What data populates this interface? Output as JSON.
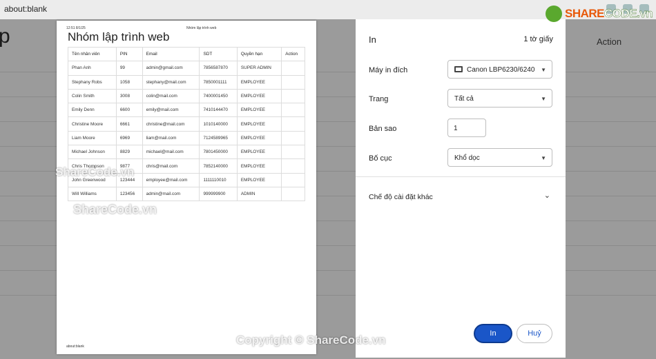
{
  "browser": {
    "url": "about:blank"
  },
  "background_page": {
    "left_glyph": "p",
    "action_label": "Action"
  },
  "sheet": {
    "header_left": "12:51 8/1/25",
    "header_center": "Nhóm lập trình web",
    "title": "Nhóm lập trình web",
    "footer": "about:blank",
    "columns": [
      "Tên nhân viên",
      "PIN",
      "Email",
      "SDT",
      "Quyền hạn",
      "Action"
    ],
    "rows": [
      [
        "Phan Anh",
        "99",
        "admin@gmail.com",
        "7856587870",
        "SUPER ADMIN",
        ""
      ],
      [
        "Stephany Robs",
        "1058",
        "stephany@mail.com",
        "7850001111",
        "EMPLOYEE",
        ""
      ],
      [
        "Colin Smith",
        "3008",
        "colin@mail.com",
        "7400001450",
        "EMPLOYEE",
        ""
      ],
      [
        "Emily Denn",
        "6600",
        "emily@mail.com",
        "7410144470",
        "EMPLOYEE",
        ""
      ],
      [
        "Christine Moore",
        "6661",
        "christine@mail.com",
        "1010140000",
        "EMPLOYEE",
        ""
      ],
      [
        "Liam Moore",
        "6969",
        "liam@mail.com",
        "7124589965",
        "EMPLOYEE",
        ""
      ],
      [
        "Michael Johnson",
        "8829",
        "michael@mail.com",
        "7801450000",
        "EMPLOYEE",
        ""
      ],
      [
        "Chris Thompson",
        "9877",
        "chris@mail.com",
        "7852140000",
        "EMPLOYEE",
        ""
      ],
      [
        "John Greenwood",
        "123444",
        "employee@mail.com",
        "1111110010",
        "EMPLOYEE",
        ""
      ],
      [
        "Will Williams",
        "123456",
        "admin@mail.com",
        "999999900",
        "ADMIN",
        ""
      ]
    ]
  },
  "print_panel": {
    "title": "In",
    "sheet_count": "1 tờ giấy",
    "destination_label": "Máy in đích",
    "destination_value": "Canon LBP6230/6240",
    "pages_label": "Trang",
    "pages_value": "Tất cả",
    "copies_label": "Bản sao",
    "copies_value": "1",
    "layout_label": "Bố cục",
    "layout_value": "Khổ dọc",
    "more_settings": "Chế độ cài đặt khác",
    "print_button": "In",
    "cancel_button": "Huỷ"
  },
  "watermarks": {
    "logo_part1": "SHARE",
    "logo_part2": "CODE.vn",
    "sheet_mark_1": "ShareCode.vn",
    "sheet_mark_2": "ShareCode.vn",
    "copyright": "Copyright © ShareCode.vn"
  },
  "colors": {
    "primary_button": "#1a56c8",
    "backdrop": "#9b9b9b"
  }
}
